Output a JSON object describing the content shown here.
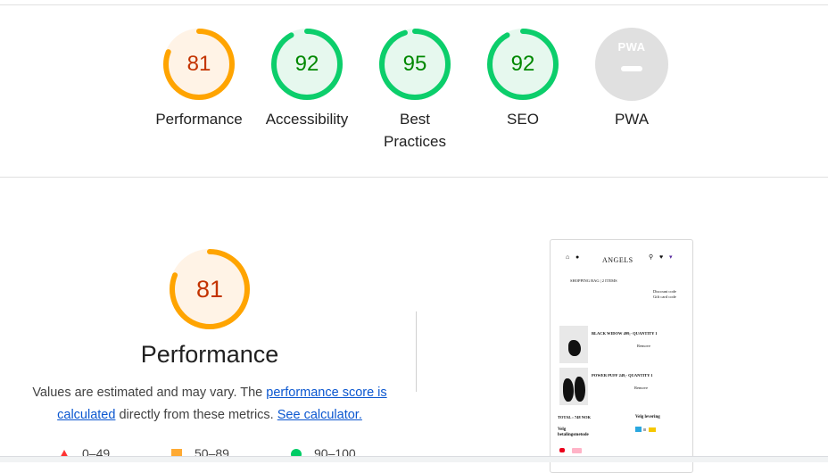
{
  "summary_gauges": [
    {
      "score": "81",
      "label": "Performance",
      "color": "#ffa400",
      "bg": "#fff3e6",
      "text_color": "#c33300",
      "fraction": 0.81
    },
    {
      "score": "92",
      "label": "Accessibility",
      "color": "#0cce6b",
      "bg": "#e6f8ee",
      "text_color": "#008800",
      "fraction": 0.92
    },
    {
      "score": "95",
      "label": "Best Practices",
      "color": "#0cce6b",
      "bg": "#e6f8ee",
      "text_color": "#008800",
      "fraction": 0.95
    },
    {
      "score": "92",
      "label": "SEO",
      "color": "#0cce6b",
      "bg": "#e6f8ee",
      "text_color": "#008800",
      "fraction": 0.92
    }
  ],
  "pwa": {
    "badge_text": "PWA",
    "label": "PWA"
  },
  "performance": {
    "score": "81",
    "fraction": 0.81,
    "title": "Performance",
    "desc_prefix": "Values are estimated and may vary. The ",
    "link_score": "performance score is calculated",
    "desc_middle": " directly from these metrics. ",
    "link_calc": "See calculator."
  },
  "legend": [
    {
      "range": "0–49",
      "shape": "triangle",
      "color": "#ff3333"
    },
    {
      "range": "50–89",
      "shape": "square",
      "color": "#ffaa33"
    },
    {
      "range": "90–100",
      "shape": "circle",
      "color": "#00cc66"
    }
  ],
  "screenshot": {
    "brand": "ANGELS",
    "bag_title": "SHOPPING BAG | 2 ITEMS",
    "discount": "Discount code",
    "gift": "Gift card code",
    "item1": "BLACK WIDOW  499,- QUANTITY 1",
    "item1_remove": "Remove",
    "item2": "POWER PUFF  249,- QUANTITY 1",
    "item2_remove": "Remove",
    "total": "TOTAL : 748 NOK",
    "delivery": "Velg levering",
    "payment1": "Velg",
    "payment2": "betalingsmetode"
  }
}
